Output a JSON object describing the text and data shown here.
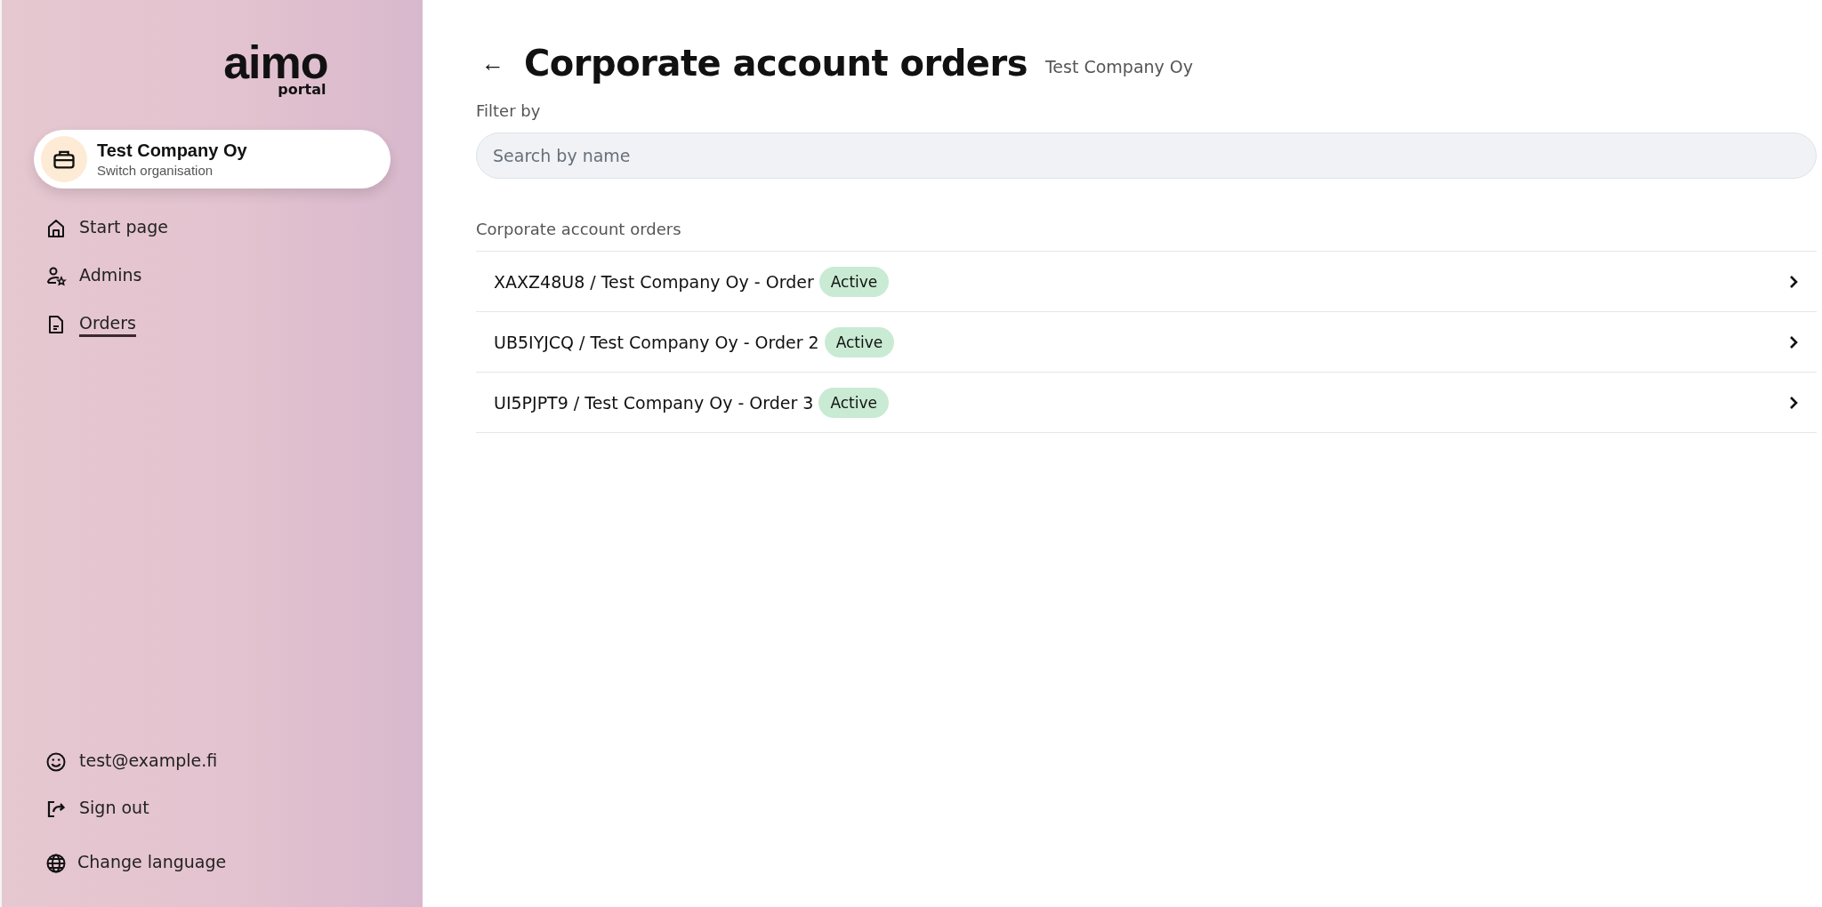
{
  "logo": {
    "wordmark": "aimo",
    "subtitle": "portal"
  },
  "organisation": {
    "name": "Test Company Oy",
    "action": "Switch organisation"
  },
  "nav": [
    {
      "kind": "home",
      "label": "Start page",
      "selected": false
    },
    {
      "kind": "admins",
      "label": "Admins",
      "selected": false
    },
    {
      "kind": "orders",
      "label": "Orders",
      "selected": true
    }
  ],
  "account": [
    {
      "kind": "user",
      "label": "test@example.fi"
    },
    {
      "kind": "signout",
      "label": "Sign out"
    },
    {
      "kind": "language",
      "label": "Change language"
    }
  ],
  "header": {
    "back": "←",
    "title": "Corporate account orders",
    "subtitle": "Test Company Oy"
  },
  "filter": {
    "label": "Filter by",
    "placeholder": "Search by name"
  },
  "list": {
    "title": "Corporate account orders",
    "rows": [
      {
        "name": "XAXZ48U8 / Test Company Oy - Order",
        "status": "Active"
      },
      {
        "name": "UB5IYJCQ / Test Company Oy - Order 2",
        "status": "Active"
      },
      {
        "name": "UI5PJPT9 / Test Company Oy - Order 3",
        "status": "Active"
      }
    ]
  }
}
